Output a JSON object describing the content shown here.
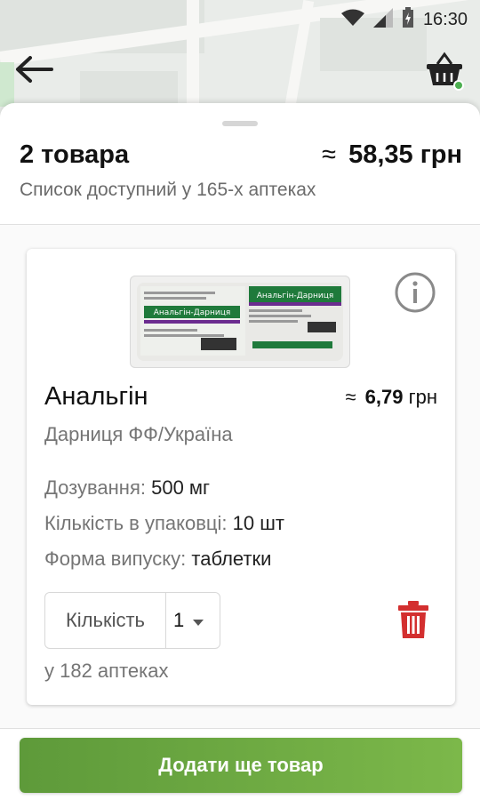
{
  "status_bar": {
    "time": "16:30",
    "icons": [
      "wifi-icon",
      "signal-icon",
      "battery-charging-icon"
    ]
  },
  "toolbar": {
    "back_icon": "arrow-left-icon",
    "basket_icon": "shopping-basket-icon",
    "basket_dot_color": "#4caf50"
  },
  "summary": {
    "count": "2 товара",
    "approx": "≈",
    "total": "58,35 грн",
    "availability": "Список доступний у 165-х аптеках"
  },
  "item": {
    "image": "product-package-image",
    "image_texts": {
      "name_on_pack": "Анальгін-Дарниця"
    },
    "name": "Анальгін",
    "price_approx": "≈",
    "price": "6,79",
    "currency": "грн",
    "manufacturer": "Дарниця ФФ/Україна",
    "specs": [
      {
        "label": "Дозування:",
        "value": "500 мг"
      },
      {
        "label": "Кількість в упаковці:",
        "value": "10 шт"
      },
      {
        "label": "Форма випуску:",
        "value": "таблетки"
      }
    ],
    "quantity_label": "Кількість",
    "quantity_value": "1",
    "pharmacies": "у 182 аптеках",
    "delete_color": "#d32f2f"
  },
  "actions": {
    "add_more": "Додати ще товар",
    "accent": "#6aa842"
  }
}
